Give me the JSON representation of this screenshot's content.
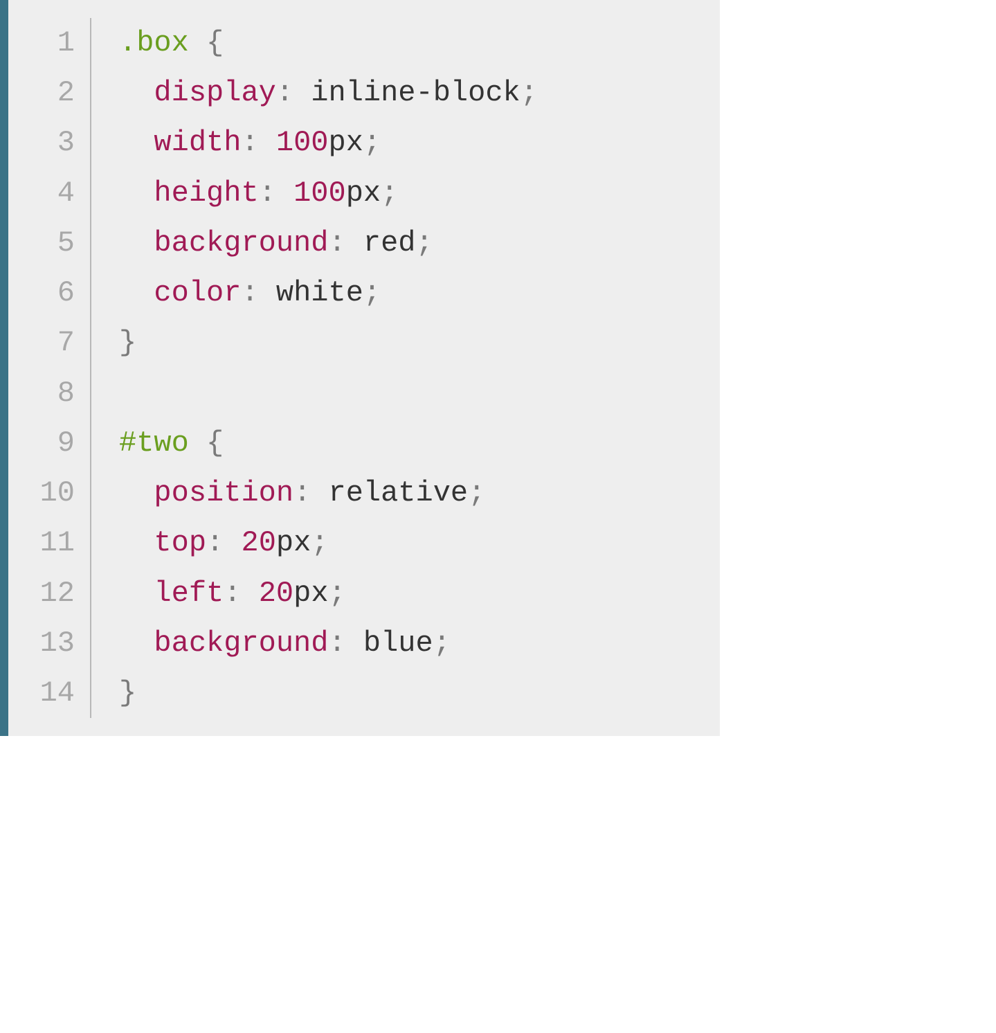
{
  "code": {
    "language": "css",
    "lines": [
      {
        "n": 1,
        "tokens": [
          {
            "t": ".box",
            "c": "sel"
          },
          {
            "t": " ",
            "c": "val"
          },
          {
            "t": "{",
            "c": "punct"
          }
        ]
      },
      {
        "n": 2,
        "tokens": [
          {
            "t": "  ",
            "c": "val"
          },
          {
            "t": "display",
            "c": "prop"
          },
          {
            "t": ":",
            "c": "punct"
          },
          {
            "t": " inline-block",
            "c": "val"
          },
          {
            "t": ";",
            "c": "punct"
          }
        ]
      },
      {
        "n": 3,
        "tokens": [
          {
            "t": "  ",
            "c": "val"
          },
          {
            "t": "width",
            "c": "prop"
          },
          {
            "t": ":",
            "c": "punct"
          },
          {
            "t": " ",
            "c": "val"
          },
          {
            "t": "100",
            "c": "num"
          },
          {
            "t": "px",
            "c": "unit"
          },
          {
            "t": ";",
            "c": "punct"
          }
        ]
      },
      {
        "n": 4,
        "tokens": [
          {
            "t": "  ",
            "c": "val"
          },
          {
            "t": "height",
            "c": "prop"
          },
          {
            "t": ":",
            "c": "punct"
          },
          {
            "t": " ",
            "c": "val"
          },
          {
            "t": "100",
            "c": "num"
          },
          {
            "t": "px",
            "c": "unit"
          },
          {
            "t": ";",
            "c": "punct"
          }
        ]
      },
      {
        "n": 5,
        "tokens": [
          {
            "t": "  ",
            "c": "val"
          },
          {
            "t": "background",
            "c": "prop"
          },
          {
            "t": ":",
            "c": "punct"
          },
          {
            "t": " red",
            "c": "val"
          },
          {
            "t": ";",
            "c": "punct"
          }
        ]
      },
      {
        "n": 6,
        "tokens": [
          {
            "t": "  ",
            "c": "val"
          },
          {
            "t": "color",
            "c": "prop"
          },
          {
            "t": ":",
            "c": "punct"
          },
          {
            "t": " white",
            "c": "val"
          },
          {
            "t": ";",
            "c": "punct"
          }
        ]
      },
      {
        "n": 7,
        "tokens": [
          {
            "t": "}",
            "c": "punct"
          }
        ]
      },
      {
        "n": 8,
        "tokens": [
          {
            "t": "",
            "c": "val"
          }
        ]
      },
      {
        "n": 9,
        "tokens": [
          {
            "t": "#two",
            "c": "sel"
          },
          {
            "t": " ",
            "c": "val"
          },
          {
            "t": "{",
            "c": "punct"
          }
        ]
      },
      {
        "n": 10,
        "tokens": [
          {
            "t": "  ",
            "c": "val"
          },
          {
            "t": "position",
            "c": "prop"
          },
          {
            "t": ":",
            "c": "punct"
          },
          {
            "t": " relative",
            "c": "val"
          },
          {
            "t": ";",
            "c": "punct"
          }
        ]
      },
      {
        "n": 11,
        "tokens": [
          {
            "t": "  ",
            "c": "val"
          },
          {
            "t": "top",
            "c": "prop"
          },
          {
            "t": ":",
            "c": "punct"
          },
          {
            "t": " ",
            "c": "val"
          },
          {
            "t": "20",
            "c": "num"
          },
          {
            "t": "px",
            "c": "unit"
          },
          {
            "t": ";",
            "c": "punct"
          }
        ]
      },
      {
        "n": 12,
        "tokens": [
          {
            "t": "  ",
            "c": "val"
          },
          {
            "t": "left",
            "c": "prop"
          },
          {
            "t": ":",
            "c": "punct"
          },
          {
            "t": " ",
            "c": "val"
          },
          {
            "t": "20",
            "c": "num"
          },
          {
            "t": "px",
            "c": "unit"
          },
          {
            "t": ";",
            "c": "punct"
          }
        ]
      },
      {
        "n": 13,
        "tokens": [
          {
            "t": "  ",
            "c": "val"
          },
          {
            "t": "background",
            "c": "prop"
          },
          {
            "t": ":",
            "c": "punct"
          },
          {
            "t": " blue",
            "c": "val"
          },
          {
            "t": ";",
            "c": "punct"
          }
        ]
      },
      {
        "n": 14,
        "tokens": [
          {
            "t": "}",
            "c": "punct"
          }
        ]
      }
    ]
  }
}
